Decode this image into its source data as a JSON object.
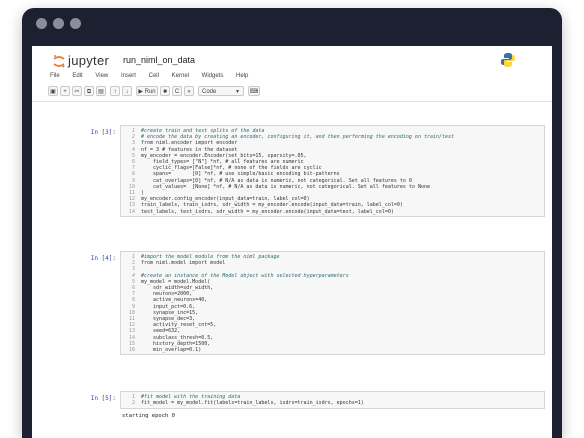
{
  "window": {
    "dot_color": "#8a8e9a",
    "frame_color": "#1d2030"
  },
  "header": {
    "logo_text": "jupyter",
    "notebook_title": "run_niml_on_data",
    "logo_icon": "jupyter-logo-icon",
    "right_icon": "python-logo-icon"
  },
  "menu": [
    "File",
    "Edit",
    "View",
    "Insert",
    "Cell",
    "Kernel",
    "Widgets",
    "Help"
  ],
  "toolbar": {
    "run_label": "▶ Run",
    "cell_type": "Code",
    "icons": [
      "save-icon",
      "add-cell-icon",
      "cut-icon",
      "copy-icon",
      "paste-icon",
      "move-up-icon",
      "move-down-icon",
      "run-icon",
      "stop-icon",
      "restart-icon",
      "fast-forward-icon",
      "cell-type-select",
      "keyboard-icon"
    ]
  },
  "cells": [
    {
      "prompt": "In [3]:",
      "lines": [
        {
          "n": "1",
          "t": "#create train and test splits of the data",
          "c": true
        },
        {
          "n": "2",
          "t": "# encode the data by creating an encoder, configuring it, and then performing the encoding on train/test",
          "c": true
        },
        {
          "n": "3",
          "t": "from niml.encoder import encoder",
          "c": false
        },
        {
          "n": "4",
          "t": "nf = 3 # features in the dataset",
          "c": false
        },
        {
          "n": "5",
          "t": "my_encoder = encoder.Encoder(set_bits=15, sparsity=.05,",
          "c": false
        },
        {
          "n": "6",
          "t": "    field_types= [\"N\"] *nf, # all features are numeric",
          "c": false
        },
        {
          "n": "7",
          "t": "    cyclic_flags=[False]*nf, # none of the fields are cyclic",
          "c": false
        },
        {
          "n": "8",
          "t": "    spans=       [0] *nf, # use simple/basic encoding bit-patterns",
          "c": false
        },
        {
          "n": "9",
          "t": "    cat_overlaps=[0] *nf, # N/A as data is numeric, not categorical. Set all features to 0",
          "c": false
        },
        {
          "n": "10",
          "t": "    cat_values=  [None] *nf, # N/A as data is numeric, not categorical. Set all features to None",
          "c": false
        },
        {
          "n": "11",
          "t": ")",
          "c": false
        },
        {
          "n": "12",
          "t": "my_encoder.config_encoder(input_data=train, label_col=0)",
          "c": false
        },
        {
          "n": "13",
          "t": "train_labels, train_isdrs, sdr_width = my_encoder.encode(input_data=train, label_col=0)",
          "c": false
        },
        {
          "n": "14",
          "t": "test_labels, test_isdrs, sdr_width = my_encoder.encode(input_data=test, label_col=0)",
          "c": false
        }
      ]
    },
    {
      "prompt": "In [4]:",
      "lines": [
        {
          "n": "1",
          "t": "#import the model module from the niml package",
          "c": true
        },
        {
          "n": "2",
          "t": "from niml.model import model",
          "c": false
        },
        {
          "n": "3",
          "t": "",
          "c": false
        },
        {
          "n": "4",
          "t": "#create an instance of the Model object with selected hyperparameters",
          "c": true
        },
        {
          "n": "5",
          "t": "my_model = model.Model(",
          "c": false
        },
        {
          "n": "6",
          "t": "    sdr_width=sdr_width,",
          "c": false
        },
        {
          "n": "7",
          "t": "    neurons=2000,",
          "c": false
        },
        {
          "n": "8",
          "t": "    active_neurons=40,",
          "c": false
        },
        {
          "n": "9",
          "t": "    input_pct=0.6,",
          "c": false
        },
        {
          "n": "10",
          "t": "    synapse_inc=15,",
          "c": false
        },
        {
          "n": "11",
          "t": "    synapse_dec=3,",
          "c": false
        },
        {
          "n": "12",
          "t": "    activity_reset_cnt=5,",
          "c": false
        },
        {
          "n": "13",
          "t": "    seed=632,",
          "c": false
        },
        {
          "n": "14",
          "t": "    subclass_thresh=0.5,",
          "c": false
        },
        {
          "n": "15",
          "t": "    history_depth=1500,",
          "c": false
        },
        {
          "n": "16",
          "t": "    min_overlap=0.1)",
          "c": false
        }
      ]
    },
    {
      "prompt": "In [5]:",
      "lines": [
        {
          "n": "1",
          "t": "#fit model with the training data",
          "c": true
        },
        {
          "n": "2",
          "t": "fit_model = my_model.fit(labels=train_labels, isdrs=train_isdrs, epochs=1)",
          "c": false
        }
      ],
      "output": "starting epoch 0"
    }
  ]
}
